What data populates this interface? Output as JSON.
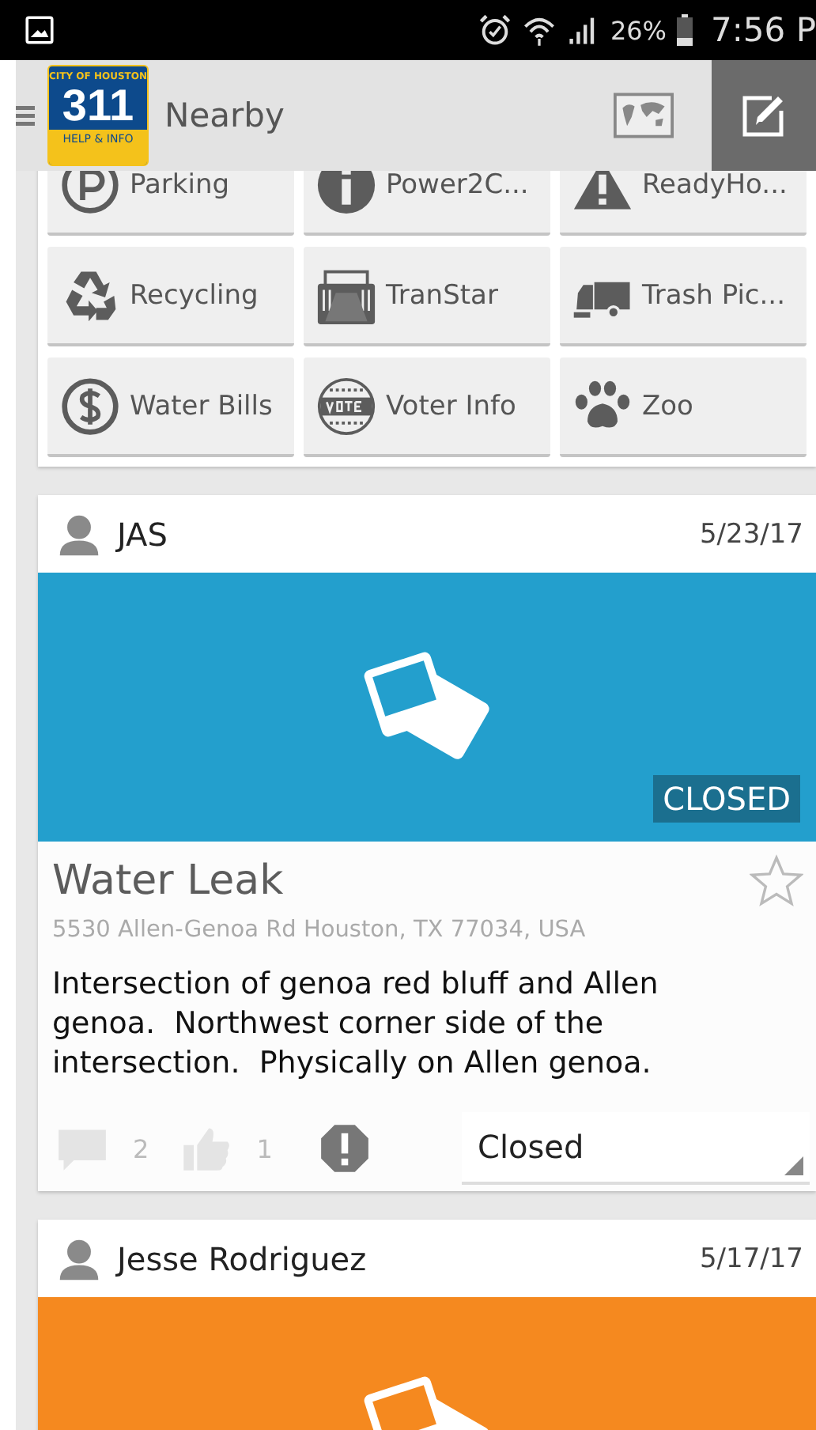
{
  "status_bar": {
    "battery": "26%",
    "time": "7:56 P"
  },
  "app_bar": {
    "logo": {
      "top": "CITY OF HOUSTON",
      "number": "311",
      "bottom": "HELP & INFO"
    },
    "title": "Nearby"
  },
  "services": [
    {
      "label": "Parking",
      "kind": "parking"
    },
    {
      "label": "Power2C...",
      "kind": "info"
    },
    {
      "label": "ReadyHo...",
      "kind": "warning"
    },
    {
      "label": "Recycling",
      "kind": "recycle"
    },
    {
      "label": "TranStar",
      "kind": "road"
    },
    {
      "label": "Trash Pic...",
      "kind": "truck"
    },
    {
      "label": "Water Bills",
      "kind": "dollar"
    },
    {
      "label": "Voter Info",
      "kind": "vote"
    },
    {
      "label": "Zoo",
      "kind": "paw"
    }
  ],
  "posts": [
    {
      "author": "JAS",
      "date": "5/23/17",
      "color": "#239fcd",
      "badge": "CLOSED",
      "title": "Water Leak",
      "starred": false,
      "address": "5530 Allen-Genoa Rd Houston, TX 77034, USA",
      "description": "Intersection of genoa red bluff and Allen genoa.  Northwest corner side of the intersection.  Physically on Allen genoa.",
      "comments": "2",
      "likes": "1",
      "status": "Closed"
    },
    {
      "author": "Jesse Rodriguez",
      "date": "5/17/17",
      "color": "#f5891f"
    }
  ]
}
